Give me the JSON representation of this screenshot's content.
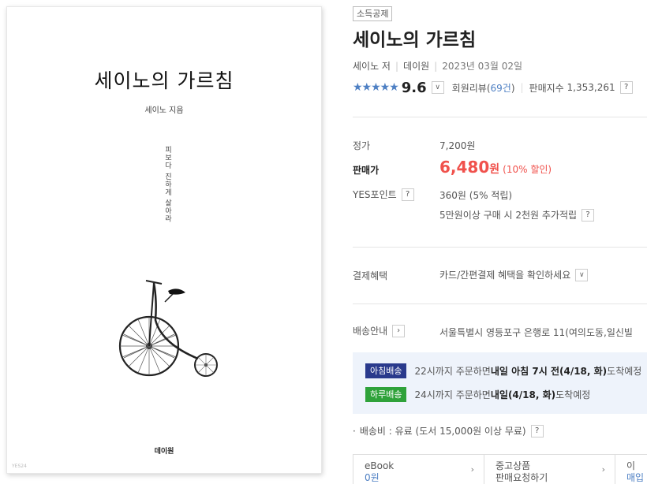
{
  "cover": {
    "title": "세이노의 가르침",
    "author": "세이노 지음",
    "tagline": "피보다 진하게 살아라",
    "publisher": "데이원",
    "corner_mark": "YES24"
  },
  "product": {
    "badge": "소득공제",
    "title": "세이노의 가르침",
    "author": "세이노 저",
    "publisher": "데이원",
    "date": "2023년 03월 02일",
    "stars": "★★★★★",
    "score": "9.6",
    "review_label": "회원리뷰(",
    "review_count": "69건",
    "review_close": ")",
    "sales_label": "판매지수",
    "sales_index": "1,353,261"
  },
  "price": {
    "list_label": "정가",
    "list_value": "7,200원",
    "sale_label": "판매가",
    "sale_value": "6,480",
    "sale_unit": "원",
    "sale_discount": "(10% 할인)",
    "point_label": "YES포인트",
    "point_value": "360원 (5% 적립)",
    "extra_point": "5만원이상 구매 시 2천원 추가적립"
  },
  "payment": {
    "label": "결제혜택",
    "value": "카드/간편결제 혜택을 확인하세요"
  },
  "shipping": {
    "label": "배송안내",
    "address": "서울특별시 영등포구 은행로 11(여의도동,일신빌",
    "morning_tag": "아침배송",
    "morning_pre": "22시까지 주문하면 ",
    "morning_bold": "내일 아침 7시 전(4/18, 화)",
    "morning_post": " 도착예정",
    "day_tag": "하루배송",
    "day_pre": "24시까지 주문하면 ",
    "day_bold": "내일(4/18, 화)",
    "day_post": " 도착예정",
    "fee": "배송비 : 유료 (도서 15,000원 이상 무료)"
  },
  "tabs": [
    {
      "title": "eBook",
      "sub": "0원"
    },
    {
      "title": "중고상품",
      "sub": "판매요청하기"
    },
    {
      "title": "이",
      "sub": "매입"
    }
  ],
  "colors": {
    "accent_blue": "#4d7fc3",
    "sale_red": "#f0514c",
    "morning_tag": "#2a3a8c",
    "day_tag": "#2fa23a",
    "delivery_bg": "#eef3fb"
  }
}
